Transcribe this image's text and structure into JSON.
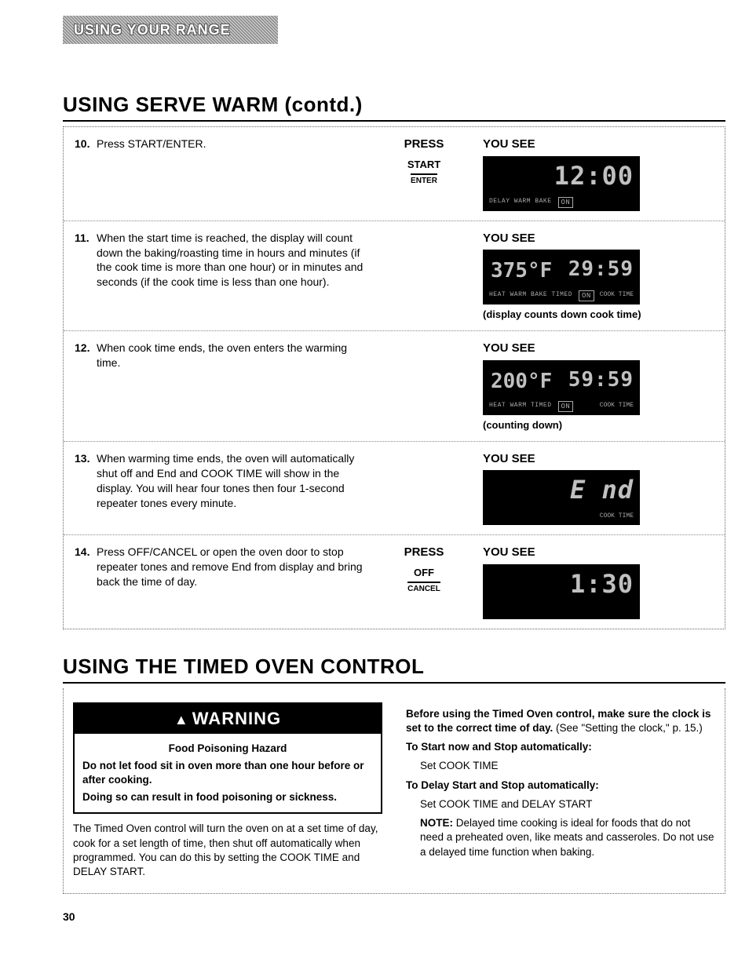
{
  "chapter": "USING YOUR RANGE",
  "h1a": "USING SERVE WARM (contd.)",
  "h1b": "USING THE TIMED OVEN CONTROL",
  "press_hdr": "PRESS",
  "see_hdr": "YOU SEE",
  "steps": {
    "s10": {
      "num": "10.",
      "txt": "Press START/ENTER.",
      "btn_top": "START",
      "btn_sub": "ENTER"
    },
    "s11": {
      "num": "11.",
      "txt": "When the start time is reached, the display will count down the baking/roasting time in hours and minutes (if the cook time is more than one hour) or in minutes and seconds (if the cook time is less than one hour).",
      "caption": "(display counts down cook time)"
    },
    "s12": {
      "num": "12.",
      "txt": "When cook time ends, the oven enters the warming time.",
      "caption": "(counting down)"
    },
    "s13": {
      "num": "13.",
      "txt": "When warming time ends, the oven will automatically shut off and End and COOK TIME will show in the display. You will hear four tones then four 1-second repeater tones every minute."
    },
    "s14": {
      "num": "14.",
      "txt": "Press OFF/CANCEL or open the oven door to stop repeater tones and remove End from display and bring back the time of day.",
      "btn_top": "OFF",
      "btn_sub": "CANCEL"
    }
  },
  "displays": {
    "d10": {
      "digits": "12:00",
      "ann_l": "DELAY  WARM BAKE",
      "on": "ON"
    },
    "d11": {
      "temp": "375°F",
      "digits": "29:59",
      "ann_l": "HEAT  WARM BAKE  TIMED",
      "on": "ON",
      "ann_r": "COOK TIME"
    },
    "d12": {
      "temp": "200°F",
      "digits": "59:59",
      "ann_l": "HEAT  WARM  TIMED",
      "on": "ON",
      "ann_r": "COOK TIME"
    },
    "d13": {
      "digits": "E nd",
      "ann_r": "COOK TIME"
    },
    "d14": {
      "digits": "1:30"
    }
  },
  "warning": {
    "title": "WARNING",
    "sub": "Food Poisoning Hazard",
    "p1": "Do not let food sit in oven more than one hour before or after cooking.",
    "p2": "Doing so can result in food poisoning or sickness."
  },
  "left_para": "The Timed Oven control will turn the oven on at a set time of day, cook for a set length of time, then shut off automatically when programmed. You can do this by setting the COOK TIME and DELAY START.",
  "right": {
    "p1a": "Before using the Timed Oven control, make sure the clock is set to the correct time of day.",
    "p1b": " (See \"Setting the clock,\" p. 15.)",
    "h2": "To Start now and Stop automatically:",
    "p2": "Set COOK TIME",
    "h3": "To Delay Start and Stop automatically:",
    "p3": "Set COOK TIME and DELAY START",
    "noteL": "NOTE:",
    "note": " Delayed time cooking is ideal for foods that do not need a preheated oven, like meats and casseroles. Do not use a delayed time function when baking."
  },
  "page": "30"
}
